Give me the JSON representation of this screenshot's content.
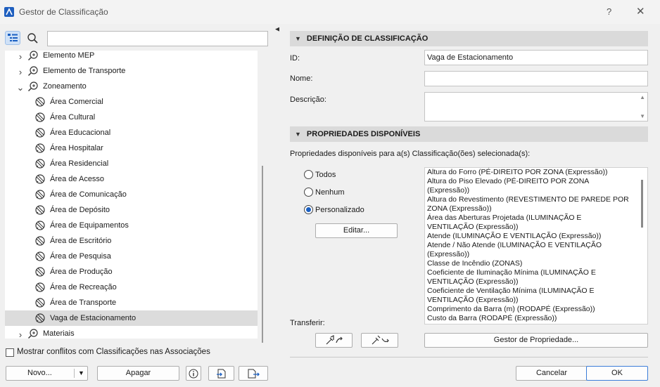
{
  "window": {
    "title": "Gestor de Classificação",
    "help_label": "?",
    "close_label": "✕"
  },
  "left": {
    "search": {
      "value": "",
      "placeholder": ""
    },
    "tree": [
      {
        "label": "Elemento MEP",
        "level": 0,
        "expand": "collapsed"
      },
      {
        "label": "Elemento de Transporte",
        "level": 0,
        "expand": "collapsed"
      },
      {
        "label": "Zoneamento",
        "level": 0,
        "expand": "expanded"
      },
      {
        "label": "Área Comercial",
        "level": 1,
        "expand": "none"
      },
      {
        "label": "Área Cultural",
        "level": 1,
        "expand": "none"
      },
      {
        "label": "Área Educacional",
        "level": 1,
        "expand": "none"
      },
      {
        "label": "Área Hospitalar",
        "level": 1,
        "expand": "none"
      },
      {
        "label": "Área Residencial",
        "level": 1,
        "expand": "none"
      },
      {
        "label": "Área de Acesso",
        "level": 1,
        "expand": "none"
      },
      {
        "label": "Área de Comunicação",
        "level": 1,
        "expand": "none"
      },
      {
        "label": "Área de Depósito",
        "level": 1,
        "expand": "none"
      },
      {
        "label": "Área de Equipamentos",
        "level": 1,
        "expand": "none"
      },
      {
        "label": "Área de Escritório",
        "level": 1,
        "expand": "none"
      },
      {
        "label": "Área de Pesquisa",
        "level": 1,
        "expand": "none"
      },
      {
        "label": "Área de Produção",
        "level": 1,
        "expand": "none"
      },
      {
        "label": "Área de Recreação",
        "level": 1,
        "expand": "none"
      },
      {
        "label": "Área de Transporte",
        "level": 1,
        "expand": "none"
      },
      {
        "label": "Vaga de Estacionamento",
        "level": 1,
        "expand": "none",
        "selected": true
      },
      {
        "label": "Materiais",
        "level": 0,
        "expand": "collapsed"
      }
    ],
    "show_conflicts_label": "Mostrar conflitos com Classificações nas Associações",
    "show_conflicts_checked": false,
    "new_label": "Novo...",
    "delete_label": "Apagar"
  },
  "right": {
    "definition_header": "DEFINIÇÃO DE CLASSIFICAÇÃO",
    "id_label": "ID:",
    "id_value": "Vaga de Estacionamento",
    "name_label": "Nome:",
    "name_value": "",
    "description_label": "Descrição:",
    "description_value": "",
    "props_header": "PROPRIEDADES DISPONÍVEIS",
    "props_intro": "Propriedades disponíveis para a(s) Classificação(ões) selecionada(s):",
    "radio_options": [
      {
        "label": "Todos",
        "checked": false
      },
      {
        "label": "Nenhum",
        "checked": false
      },
      {
        "label": "Personalizado",
        "checked": true
      }
    ],
    "edit_label": "Editar...",
    "property_lines": [
      "Altura do Forro (PÉ-DIREITO POR ZONA (Expressão))",
      "Altura do Piso Elevado (PÉ-DIREITO POR ZONA",
      "(Expressão))",
      "Altura do Revestimento (REVESTIMENTO DE PAREDE POR",
      "ZONA (Expressão))",
      "Área das Aberturas Projetada (ILUMINAÇÃO E",
      "VENTILAÇÃO (Expressão))",
      "Atende (ILUMINAÇÃO E VENTILAÇÃO (Expressão))",
      "Atende / Não Atende (ILUMINAÇÃO E VENTILAÇÃO",
      "(Expressão))",
      "Classe de Incêndio (ZONAS)",
      "Coeficiente de Iluminação Mínima (ILUMINAÇÃO E",
      "VENTILAÇÃO (Expressão))",
      "Coeficiente de Ventilação Mínima (ILUMINAÇÃO E",
      "VENTILAÇÃO (Expressão))",
      "Comprimento da Barra (m) (RODAPÉ (Expressão))",
      "Custo da Barra (RODAPÉ (Expressão))"
    ],
    "transfer_label": "Transferir:",
    "property_manager_label": "Gestor de Propriedade...",
    "cancel_label": "Cancelar",
    "ok_label": "OK"
  },
  "colors": {
    "accent": "#1a5fc2",
    "selected_row": "#dcdcdc",
    "section_header": "#dadada"
  }
}
